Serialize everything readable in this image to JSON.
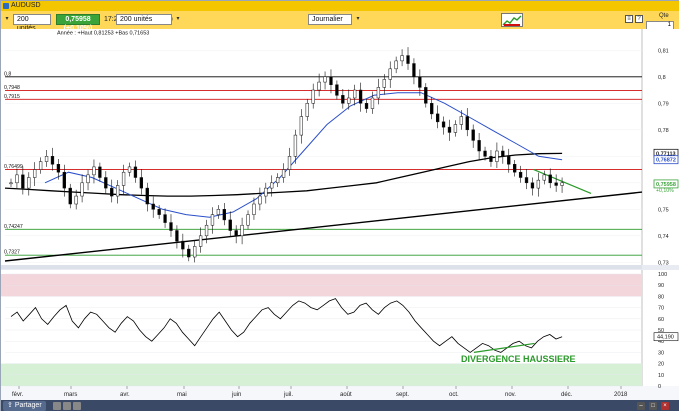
{
  "window": {
    "title": "AUDUSD"
  },
  "toolbar": {
    "units": "200 unités",
    "price": "0,75958 (+0,10%)",
    "time_text": "17:27:22 AUD/USD ( )",
    "period": "Journalier",
    "qte_label": "Qte",
    "qte_value": "1",
    "logo_icon": "zoom-trend-logo-icon"
  },
  "taskbar": {
    "share_label": "Partager"
  },
  "colors": {
    "up_candle": "#ffffff",
    "down_candle": "#000000",
    "sma_long": "#000000",
    "sma_short": "#2a4fc9",
    "rsi_line": "#000000",
    "level_red": "#d01010",
    "level_green": "#2a9a2a",
    "level_black": "#000000",
    "divergence_text": "#2a9a2a",
    "price_tag": "#3aa43a",
    "sma_tag": "#1a1a1a"
  },
  "chart_data": [
    {
      "type": "candlestick",
      "legend": "Année : +Haut 0,81253 +Bas 0,71653",
      "yaxis": {
        "ticks": [
          "0,81",
          "0,8",
          "0,79",
          "0,78",
          "0,77",
          "0,76",
          "0,75",
          "0,74",
          "0,73"
        ],
        "range": [
          0.7305,
          0.8135
        ]
      },
      "xaxis": {
        "ticks": [
          "févr.",
          "mars",
          "avr.",
          "mai",
          "juin",
          "juil.",
          "août",
          "sept.",
          "oct.",
          "nov.",
          "déc.",
          "2018"
        ]
      },
      "levels": [
        {
          "label": "0,8",
          "value": 0.8,
          "color": "black"
        },
        {
          "label": "0,7948",
          "value": 0.7948,
          "color": "red"
        },
        {
          "label": "0,7915",
          "value": 0.7915,
          "color": "red"
        },
        {
          "label": "0,76499",
          "value": 0.76499,
          "color": "red"
        },
        {
          "label": "0,74247",
          "value": 0.74247,
          "color": "green"
        },
        {
          "label": "0,7327",
          "value": 0.7327,
          "color": "green"
        }
      ],
      "tags": [
        {
          "label": "0,77113",
          "value": 0.77113,
          "kind": "sma-long"
        },
        {
          "label": "0,76872",
          "value": 0.76872,
          "kind": "sma-short"
        },
        {
          "label": "0,75958",
          "value": 0.75958,
          "kind": "price"
        },
        {
          "label": "+0,10%",
          "value": 0.7572,
          "kind": "change"
        }
      ],
      "price_path": [
        0.76,
        0.763,
        0.758,
        0.762,
        0.765,
        0.768,
        0.77,
        0.767,
        0.764,
        0.758,
        0.752,
        0.755,
        0.76,
        0.763,
        0.766,
        0.762,
        0.758,
        0.755,
        0.759,
        0.764,
        0.766,
        0.762,
        0.758,
        0.752,
        0.75,
        0.748,
        0.745,
        0.742,
        0.738,
        0.735,
        0.732,
        0.736,
        0.74,
        0.744,
        0.748,
        0.75,
        0.746,
        0.742,
        0.74,
        0.744,
        0.748,
        0.752,
        0.755,
        0.758,
        0.76,
        0.762,
        0.765,
        0.77,
        0.778,
        0.785,
        0.79,
        0.795,
        0.798,
        0.8,
        0.797,
        0.793,
        0.79,
        0.792,
        0.795,
        0.79,
        0.788,
        0.792,
        0.796,
        0.799,
        0.803,
        0.806,
        0.808,
        0.805,
        0.8,
        0.796,
        0.79,
        0.786,
        0.783,
        0.781,
        0.779,
        0.782,
        0.785,
        0.78,
        0.776,
        0.772,
        0.77,
        0.768,
        0.772,
        0.77,
        0.767,
        0.764,
        0.762,
        0.76,
        0.758,
        0.761,
        0.763,
        0.76,
        0.759,
        0.76
      ],
      "sma_long": [
        0.758,
        0.7575,
        0.757,
        0.7565,
        0.756,
        0.7555,
        0.7552,
        0.755,
        0.755,
        0.7552,
        0.7555,
        0.756,
        0.7565,
        0.757,
        0.758,
        0.759,
        0.76,
        0.762,
        0.764,
        0.766,
        0.768,
        0.7695,
        0.7705,
        0.771,
        0.7711
      ],
      "sma_short": [
        0.76,
        0.764,
        0.762,
        0.758,
        0.754,
        0.75,
        0.748,
        0.747,
        0.749,
        0.754,
        0.762,
        0.772,
        0.782,
        0.789,
        0.793,
        0.794,
        0.794,
        0.79,
        0.785,
        0.78,
        0.775,
        0.77,
        0.7687
      ],
      "trendline": {
        "from": [
          0,
          0.7305
        ],
        "to": [
          1,
          0.7565
        ]
      },
      "resistance_line": {
        "from": [
          0.83,
          0.765
        ],
        "to": [
          0.92,
          0.756
        ]
      }
    },
    {
      "type": "line",
      "name": "RSI",
      "yaxis": {
        "ticks": [
          "100",
          "90",
          "80",
          "70",
          "60",
          "50",
          "40",
          "30",
          "20",
          "10",
          "0"
        ],
        "range": [
          0,
          100
        ]
      },
      "current_label": "44,190",
      "zones": [
        {
          "from": 80,
          "to": 100,
          "color": "red"
        },
        {
          "from": 0,
          "to": 20,
          "color": "green"
        }
      ],
      "values": [
        62,
        66,
        58,
        64,
        70,
        60,
        55,
        62,
        68,
        72,
        58,
        52,
        60,
        66,
        64,
        58,
        52,
        48,
        56,
        62,
        58,
        50,
        44,
        40,
        46,
        52,
        60,
        56,
        48,
        42,
        36,
        44,
        52,
        60,
        66,
        58,
        50,
        44,
        48,
        56,
        62,
        68,
        70,
        64,
        60,
        66,
        72,
        76,
        74,
        70,
        68,
        72,
        76,
        78,
        70,
        64,
        66,
        72,
        74,
        68,
        64,
        70,
        74,
        76,
        72,
        66,
        58,
        52,
        46,
        40,
        36,
        40,
        44,
        38,
        34,
        30,
        34,
        38,
        36,
        32,
        30,
        34,
        38,
        40,
        36,
        34,
        40,
        44,
        46,
        42,
        44
      ],
      "annotation": "DIVERGENCE HAUSSIERE"
    }
  ]
}
